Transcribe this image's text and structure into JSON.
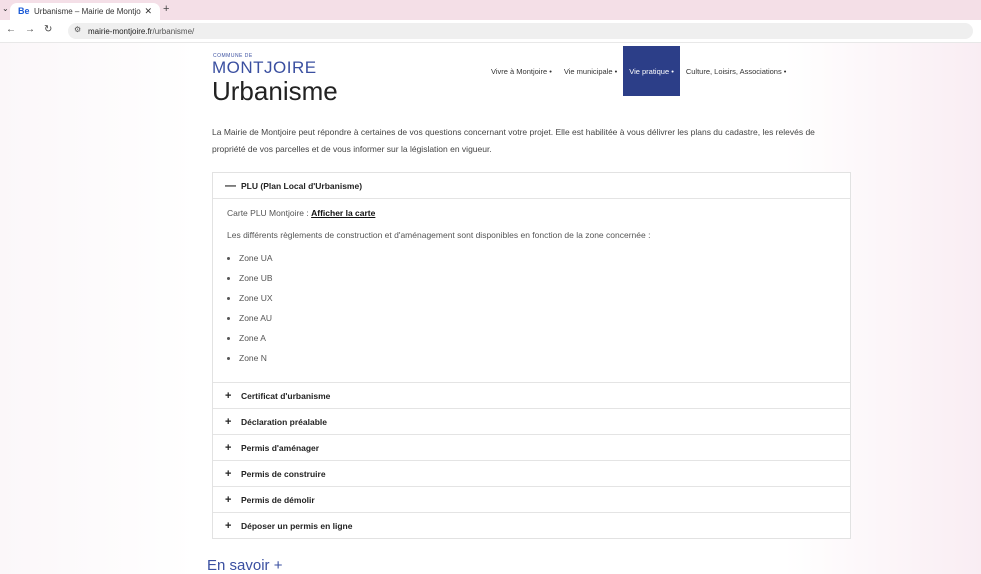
{
  "browser": {
    "tab_title": "Urbanisme – Mairie de Montjo",
    "tab_favicon": "Be",
    "url_domain": "mairie-montjoire.fr",
    "url_path": "/urbanisme/"
  },
  "site": {
    "brand_small": "COMMUNE DE",
    "brand": "MONTJOIRE",
    "page_title": "Urbanisme",
    "menu": [
      {
        "label": "Vivre à Montjoire •"
      },
      {
        "label": "Vie municipale •"
      },
      {
        "label": "Vie pratique •"
      },
      {
        "label": "Culture, Loisirs, Associations •"
      }
    ],
    "accent_color": "#2c3e88"
  },
  "intro": "La Mairie de Montjoire peut répondre à certaines de vos questions concernant votre projet. Elle est habilitée à vous délivrer les plans du cadastre, les relevés de propriété de vos parcelles et de vous informer sur la législation en vigueur.",
  "accordion": {
    "open_section": {
      "title": "PLU (Plan Local d'Urbanisme)",
      "map_label": "Carte PLU Montjoire :",
      "map_link": "Afficher la carte",
      "description": "Les différents règlements de construction et d'aménagement sont disponibles en fonction de la zone concernée :",
      "zones": [
        "Zone UA",
        "Zone UB",
        "Zone UX",
        "Zone AU",
        "Zone A",
        "Zone N"
      ]
    },
    "closed_sections": [
      "Certificat d'urbanisme",
      "Déclaration préalable",
      "Permis d'aménager",
      "Permis de construire",
      "Permis de démolir",
      "Déposer un permis en ligne"
    ]
  },
  "more_link": "En savoir +"
}
